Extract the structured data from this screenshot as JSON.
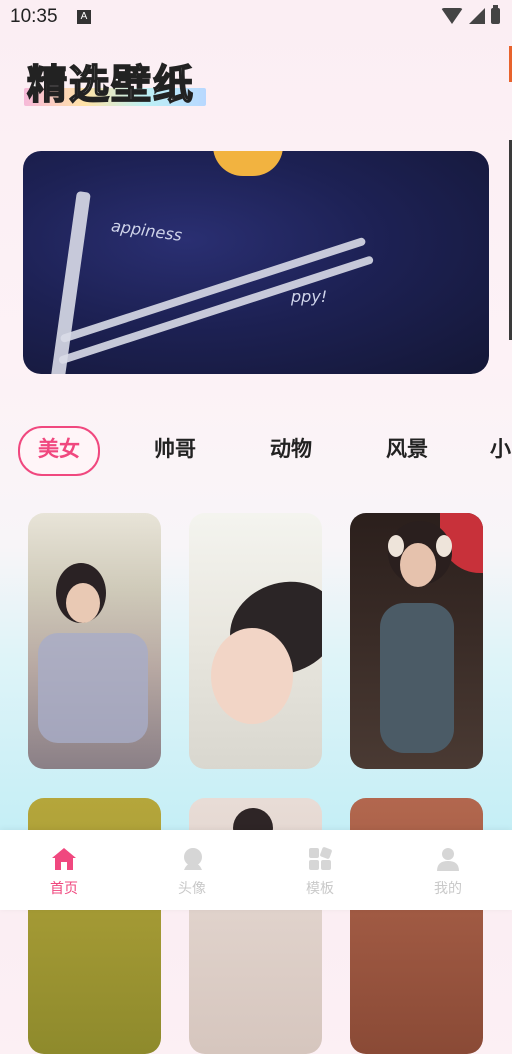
{
  "status_bar": {
    "time": "10:35",
    "notification_icon": "A"
  },
  "header": {
    "title": "精选壁纸"
  },
  "banner": {
    "shirt_text_1": "appiness",
    "shirt_text_2": "ppy!"
  },
  "category_tabs": [
    {
      "label": "美女",
      "active": true
    },
    {
      "label": "帅哥",
      "active": false
    },
    {
      "label": "动物",
      "active": false
    },
    {
      "label": "风景",
      "active": false
    },
    {
      "label": "小",
      "active": false
    }
  ],
  "bottom_nav": [
    {
      "label": "首页",
      "icon": "home-icon",
      "active": true
    },
    {
      "label": "头像",
      "icon": "avatar-icon",
      "active": false
    },
    {
      "label": "模板",
      "icon": "template-icon",
      "active": false
    },
    {
      "label": "我的",
      "icon": "profile-icon",
      "active": false
    }
  ],
  "colors": {
    "accent": "#f0487f",
    "inactive": "#c9c9c9"
  }
}
